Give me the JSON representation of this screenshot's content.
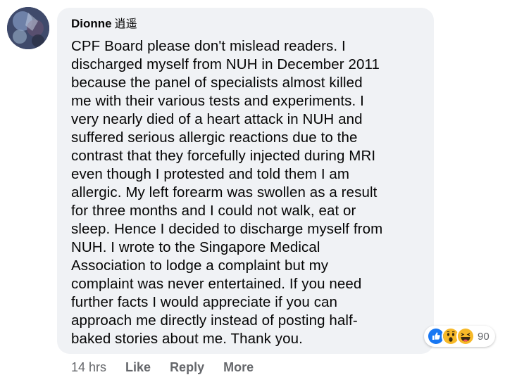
{
  "comment": {
    "author": "Dionne",
    "author_cjk": "逍遥",
    "text": "CPF Board please don't mislead readers. I\ndischarged myself from NUH in December 2011\nbecause the panel of specialists almost killed\nme with their various tests and experiments. I\nvery nearly died of a heart attack in NUH and\nsuffered serious allergic reactions due to the\ncontrast that they forcefully injected during MRI\neven though I protested and told them I am\nallergic. My left forearm was swollen as a result\nfor three months and I could not walk, eat or\nsleep. Hence I decided to discharge myself from\nNUH. I wrote to the Singapore Medical\nAssociation to lodge a complaint but my\ncomplaint was never entertained. If you need\nfurther facts I would appreciate if you can\napproach me directly instead of posting half-\nbaked stories about me. Thank you."
  },
  "reactions": {
    "icons": [
      "like-icon",
      "wow-icon",
      "haha-icon"
    ],
    "count": "90"
  },
  "actions": {
    "time": "14 hrs",
    "like": "Like",
    "reply": "Reply",
    "more": "More"
  },
  "colors": {
    "bubble": "#f0f2f5",
    "text": "#050505",
    "secondary": "#65676b",
    "like_blue": "#1877f2",
    "reaction_yellow": "#f7b928"
  }
}
